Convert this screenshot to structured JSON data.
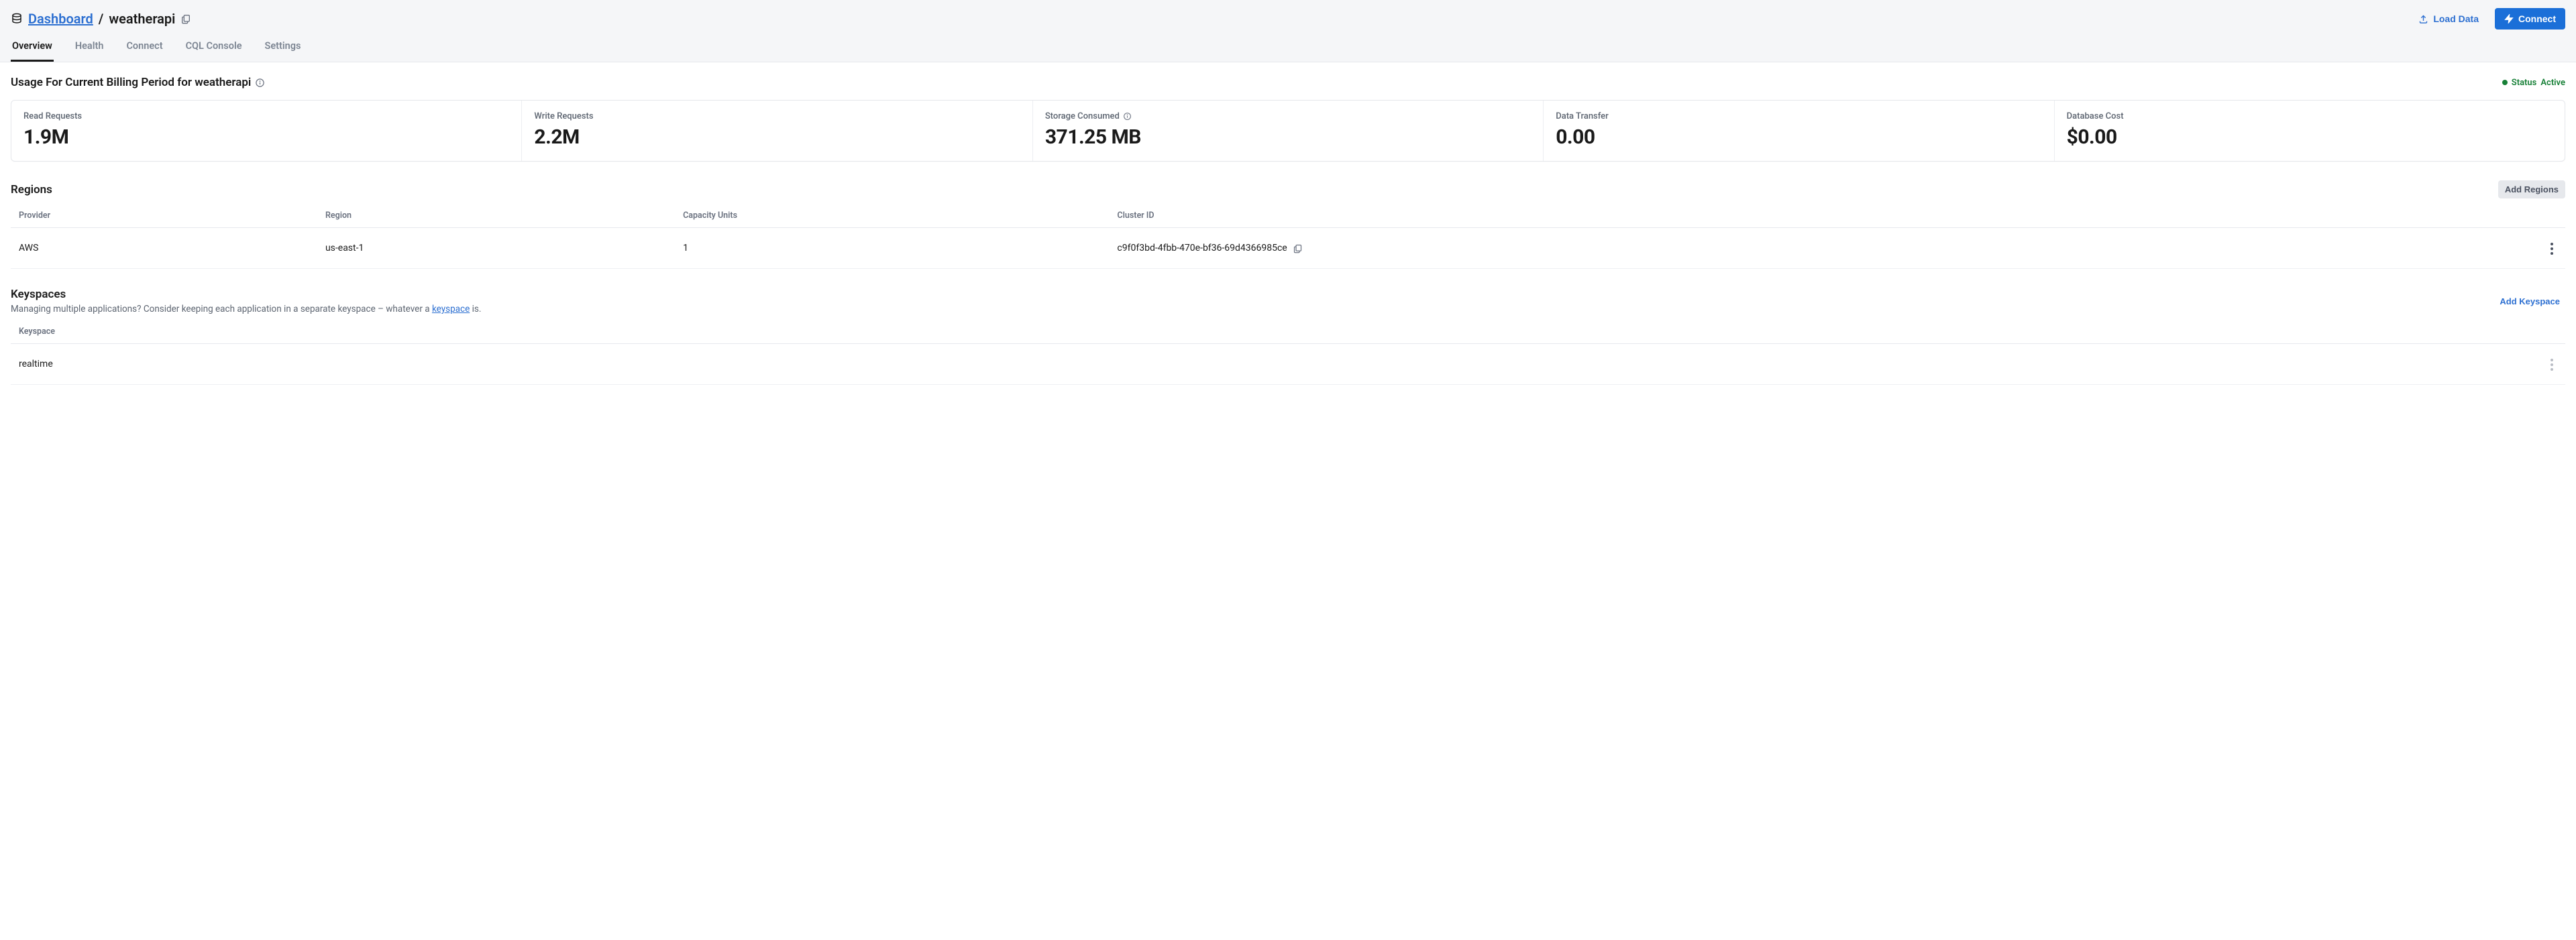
{
  "breadcrumb": {
    "root": "Dashboard",
    "separator": "/",
    "current": "weatherapi"
  },
  "header_actions": {
    "load_data": "Load Data",
    "connect": "Connect"
  },
  "tabs": [
    {
      "id": "overview",
      "label": "Overview",
      "active": true
    },
    {
      "id": "health",
      "label": "Health",
      "active": false
    },
    {
      "id": "connect",
      "label": "Connect",
      "active": false
    },
    {
      "id": "cql_console",
      "label": "CQL Console",
      "active": false
    },
    {
      "id": "settings",
      "label": "Settings",
      "active": false
    }
  ],
  "usage": {
    "title": "Usage For Current Billing Period for weatherapi",
    "status_label": "Status",
    "status_value": "Active",
    "metrics": [
      {
        "label": "Read Requests",
        "value": "1.9M",
        "info": false
      },
      {
        "label": "Write Requests",
        "value": "2.2M",
        "info": false
      },
      {
        "label": "Storage Consumed",
        "value": "371.25 MB",
        "info": true
      },
      {
        "label": "Data Transfer",
        "value": "0.00",
        "info": false
      },
      {
        "label": "Database Cost",
        "value": "$0.00",
        "info": false
      }
    ]
  },
  "regions": {
    "title": "Regions",
    "add_label": "Add Regions",
    "columns": [
      "Provider",
      "Region",
      "Capacity Units",
      "Cluster ID"
    ],
    "rows": [
      {
        "provider": "AWS",
        "region": "us-east-1",
        "capacity_units": "1",
        "cluster_id": "c9f0f3bd-4fbb-470e-bf36-69d4366985ce"
      }
    ]
  },
  "keyspaces": {
    "title": "Keyspaces",
    "subtitle_pre": "Managing multiple applications? Consider keeping each application in a separate keyspace – whatever a ",
    "subtitle_link": "keyspace",
    "subtitle_post": " is.",
    "add_label": "Add Keyspace",
    "columns": [
      "Keyspace"
    ],
    "rows": [
      {
        "name": "realtime"
      }
    ]
  }
}
